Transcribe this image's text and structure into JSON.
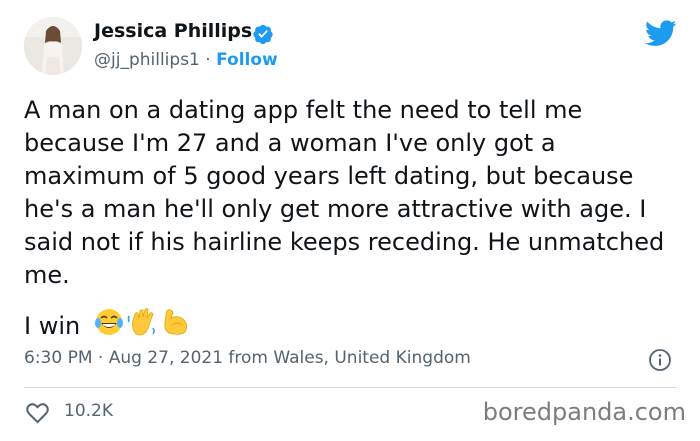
{
  "author": {
    "name": "Jessica Phillips",
    "handle": "@jj_phillips1",
    "separator": "·",
    "follow_label": "Follow"
  },
  "tweet": {
    "text": "A man on a dating app felt the need to tell me because I'm 27 and a woman I've only got a maximum of 5 good years left dating, but because he's a man he'll only get more attractive with age. I said not if his hairline keeps receding. He unmatched me.",
    "closing": "I win",
    "emojis": [
      "face-with-tears-of-joy",
      "waving-hand",
      "flexed-biceps"
    ]
  },
  "meta": {
    "timestamp": "6:30 PM · Aug 27, 2021 from Wales, United Kingdom"
  },
  "engagement": {
    "likes": "10.2K"
  },
  "watermark": "boredpanda.com",
  "colors": {
    "accent": "#1d9bf0",
    "text": "#0f1419",
    "muted": "#536471",
    "heart": "#f91880"
  },
  "icons": [
    "verified-badge-icon",
    "twitter-bird-icon",
    "info-icon",
    "heart-icon"
  ]
}
